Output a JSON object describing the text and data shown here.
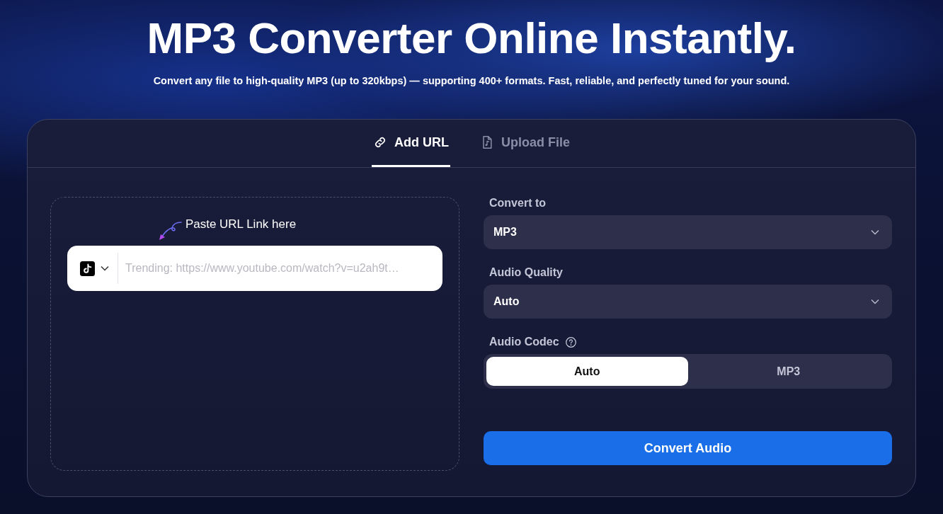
{
  "hero": {
    "title": "MP3 Converter Online Instantly.",
    "subtitle": "Convert any file to high-quality MP3 (up to 320kbps) — supporting 400+ formats. Fast, reliable, and perfectly tuned for your sound."
  },
  "tabs": [
    {
      "label": "Add URL",
      "kind": "link",
      "selected": true
    },
    {
      "label": "Upload File",
      "kind": "file",
      "selected": false
    }
  ],
  "url_panel": {
    "hint": "Paste URL Link here",
    "placeholder": "Trending: https://www.youtube.com/watch?v=u2ah9t…"
  },
  "settings": {
    "convert_to": {
      "label": "Convert to",
      "value": "MP3"
    },
    "audio_quality": {
      "label": "Audio Quality",
      "value": "Auto"
    },
    "audio_codec": {
      "label": "Audio Codec",
      "options": [
        {
          "label": "Auto",
          "selected": true
        },
        {
          "label": "MP3",
          "selected": false
        }
      ]
    }
  },
  "convert_button": "Convert Audio"
}
